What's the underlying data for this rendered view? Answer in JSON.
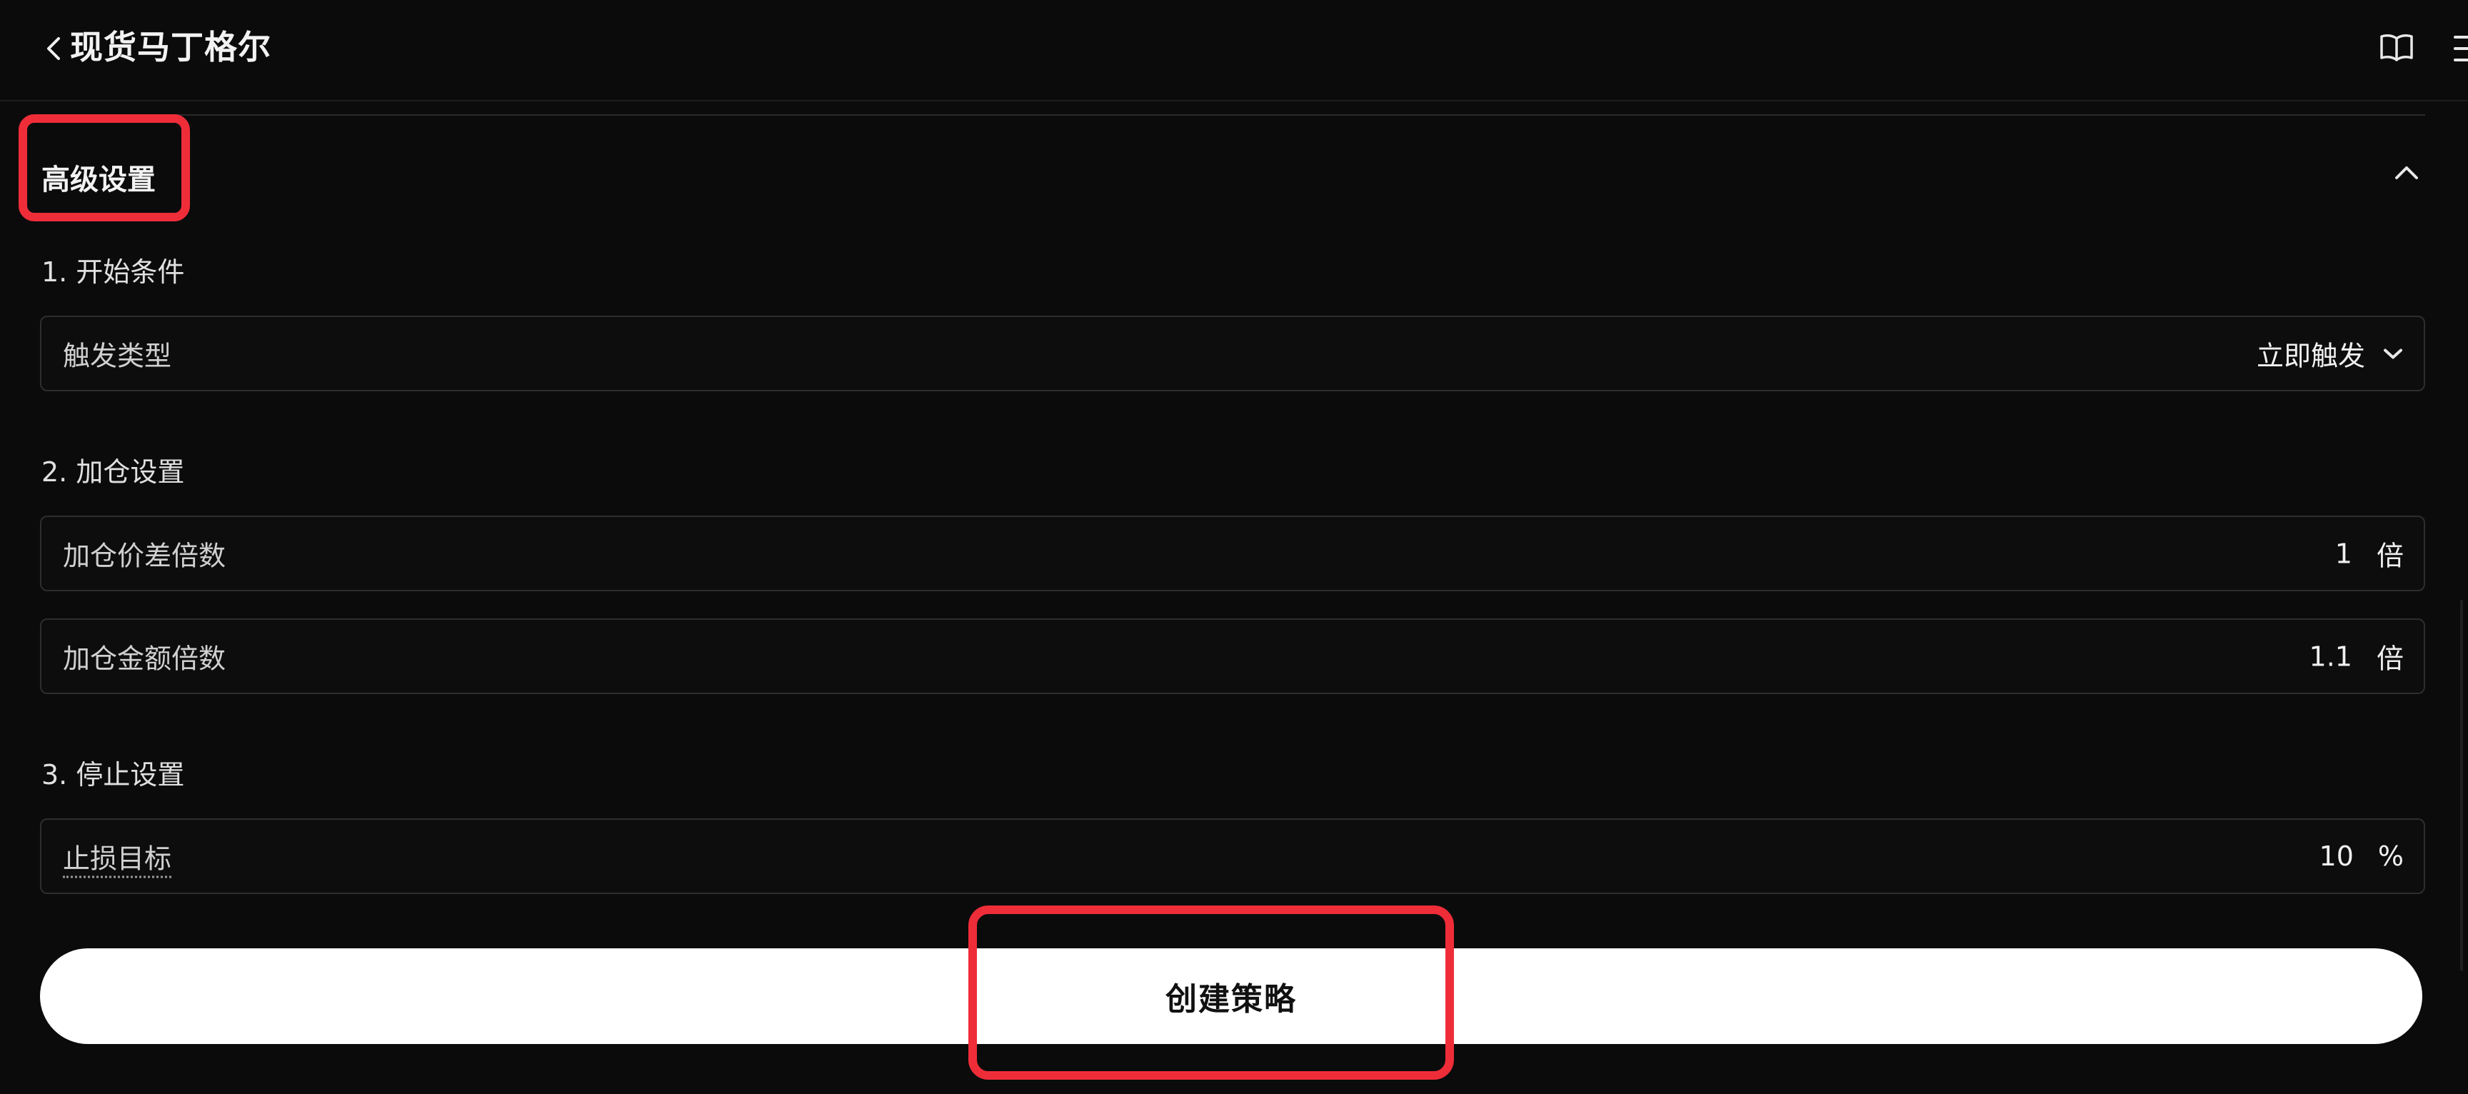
{
  "header": {
    "title": "现货马丁格尔",
    "back_icon": "chevron-left-icon",
    "book_icon": "book-icon",
    "menu_icon": "list-icon"
  },
  "advanced": {
    "title": "高级设置",
    "collapse_icon": "chevron-up-icon"
  },
  "start_conditions": {
    "heading": "1. 开始条件",
    "trigger_type": {
      "label": "触发类型",
      "value": "立即触发"
    }
  },
  "add_position": {
    "heading": "2. 加仓设置",
    "price_diff": {
      "label": "加仓价差倍数",
      "value": "1",
      "unit": "倍"
    },
    "amount": {
      "label": "加仓金额倍数",
      "value": "1.1",
      "unit": "倍"
    }
  },
  "stop": {
    "heading": "3. 停止设置",
    "take_profit": {
      "label": "止损目标",
      "value": "10",
      "unit": "%"
    }
  },
  "create_button": {
    "label": "创建策略"
  },
  "colors": {
    "background": "#0b0b0c",
    "highlight": "#ef2d39",
    "button": "#ffffff"
  }
}
